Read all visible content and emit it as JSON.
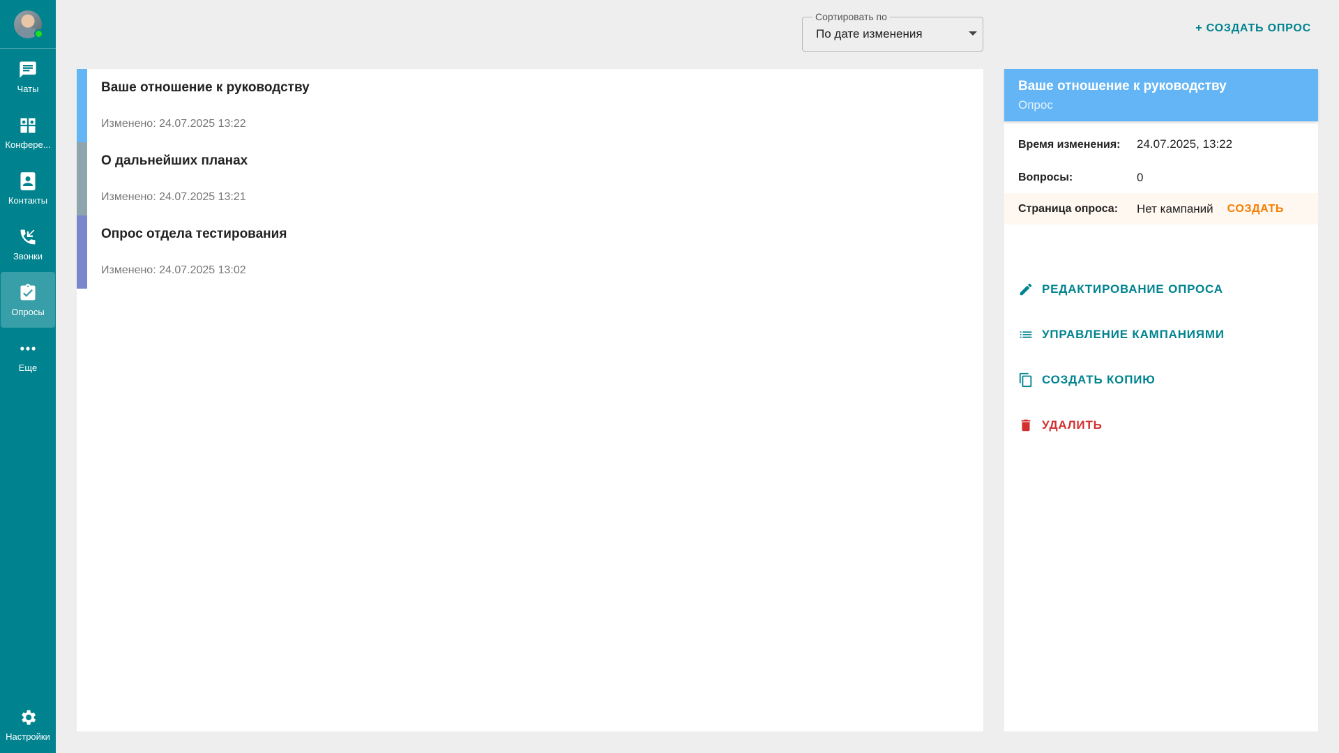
{
  "sidebar": {
    "items": [
      {
        "label": "Чаты",
        "icon": "chat-icon"
      },
      {
        "label": "Конфере...",
        "icon": "conference-icon"
      },
      {
        "label": "Контакты",
        "icon": "contacts-icon"
      },
      {
        "label": "Звонки",
        "icon": "calls-icon"
      },
      {
        "label": "Опросы",
        "icon": "surveys-icon",
        "active": true
      },
      {
        "label": "Еще",
        "icon": "more-icon"
      }
    ],
    "settings_label": "Настройки"
  },
  "topbar": {
    "sort_label": "Сортировать по",
    "sort_value": "По дате изменения",
    "create_label": "+ СОЗДАТЬ ОПРОС"
  },
  "surveys": [
    {
      "title": "Ваше отношение к руководству",
      "modified": "Изменено: 24.07.2025 13:22",
      "color": "#64b5f6"
    },
    {
      "title": "О дальнейших планах",
      "modified": "Изменено: 24.07.2025 13:21",
      "color": "#90a4ae"
    },
    {
      "title": "Опрос отдела тестирования",
      "modified": "Изменено: 24.07.2025 13:02",
      "color": "#7986cb"
    }
  ],
  "details": {
    "title": "Ваше отношение к руководству",
    "type": "Опрос",
    "time_label": "Время изменения:",
    "time_value": "24.07.2025, 13:22",
    "questions_label": "Вопросы:",
    "questions_value": "0",
    "page_label": "Страница опроса:",
    "page_value": "Нет кампаний",
    "page_create": "СОЗДАТЬ",
    "actions": {
      "edit": "РЕДАКТИРОВАНИЕ ОПРОСА",
      "campaigns": "УПРАВЛЕНИЕ КАМПАНИЯМИ",
      "copy": "СОЗДАТЬ КОПИЮ",
      "delete": "УДАЛИТЬ"
    }
  },
  "colors": {
    "sidebar": "#00838f",
    "accent": "#00838f",
    "header": "#64b5f6",
    "warning": "#f57c00",
    "danger": "#d32f2f"
  }
}
